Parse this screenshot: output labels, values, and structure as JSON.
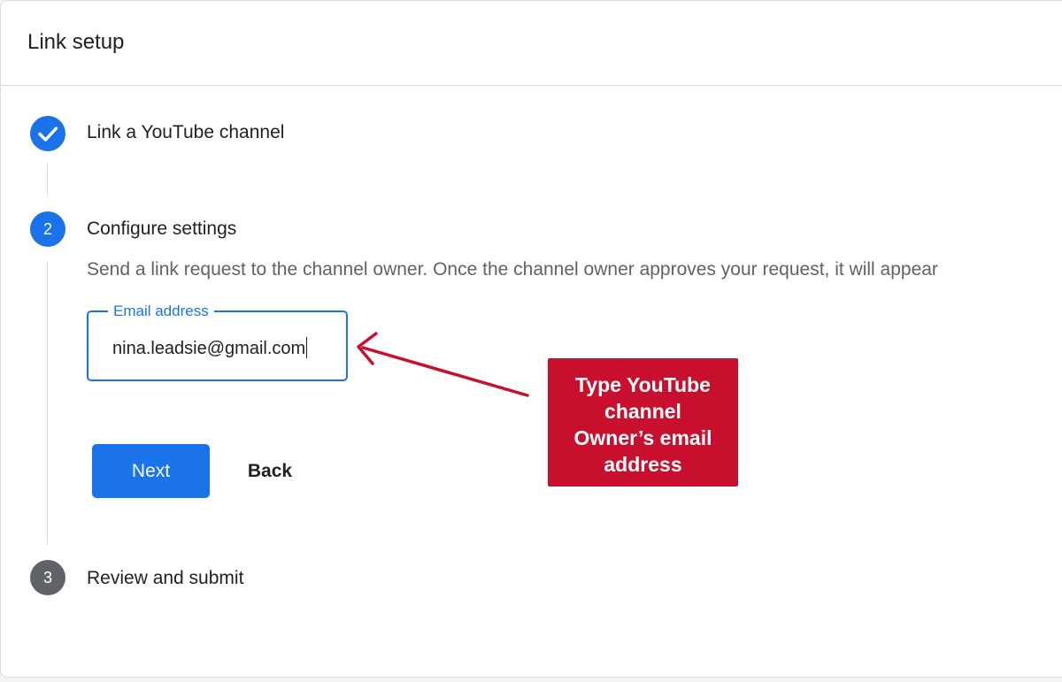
{
  "card": {
    "title": "Link setup"
  },
  "steps": [
    {
      "number": "",
      "icon": "check-icon",
      "status": "completed",
      "label": "Link a YouTube channel"
    },
    {
      "number": "2",
      "icon": "",
      "status": "active",
      "label": "Configure settings"
    },
    {
      "number": "3",
      "icon": "",
      "status": "pending",
      "label": "Review and submit"
    }
  ],
  "configure": {
    "description": "Send a link request to the channel owner. Once the channel owner approves your request, it will appear",
    "email_label": "Email address",
    "email_value": "nina.leadsie@gmail.com",
    "next_label": "Next",
    "back_label": "Back"
  },
  "annotation": {
    "lines": [
      "Type YouTube",
      "channel",
      "Owner’s email",
      "address"
    ]
  },
  "colors": {
    "accent": "#1a73e8",
    "callout": "#c8102e",
    "pending": "#5f6368"
  }
}
